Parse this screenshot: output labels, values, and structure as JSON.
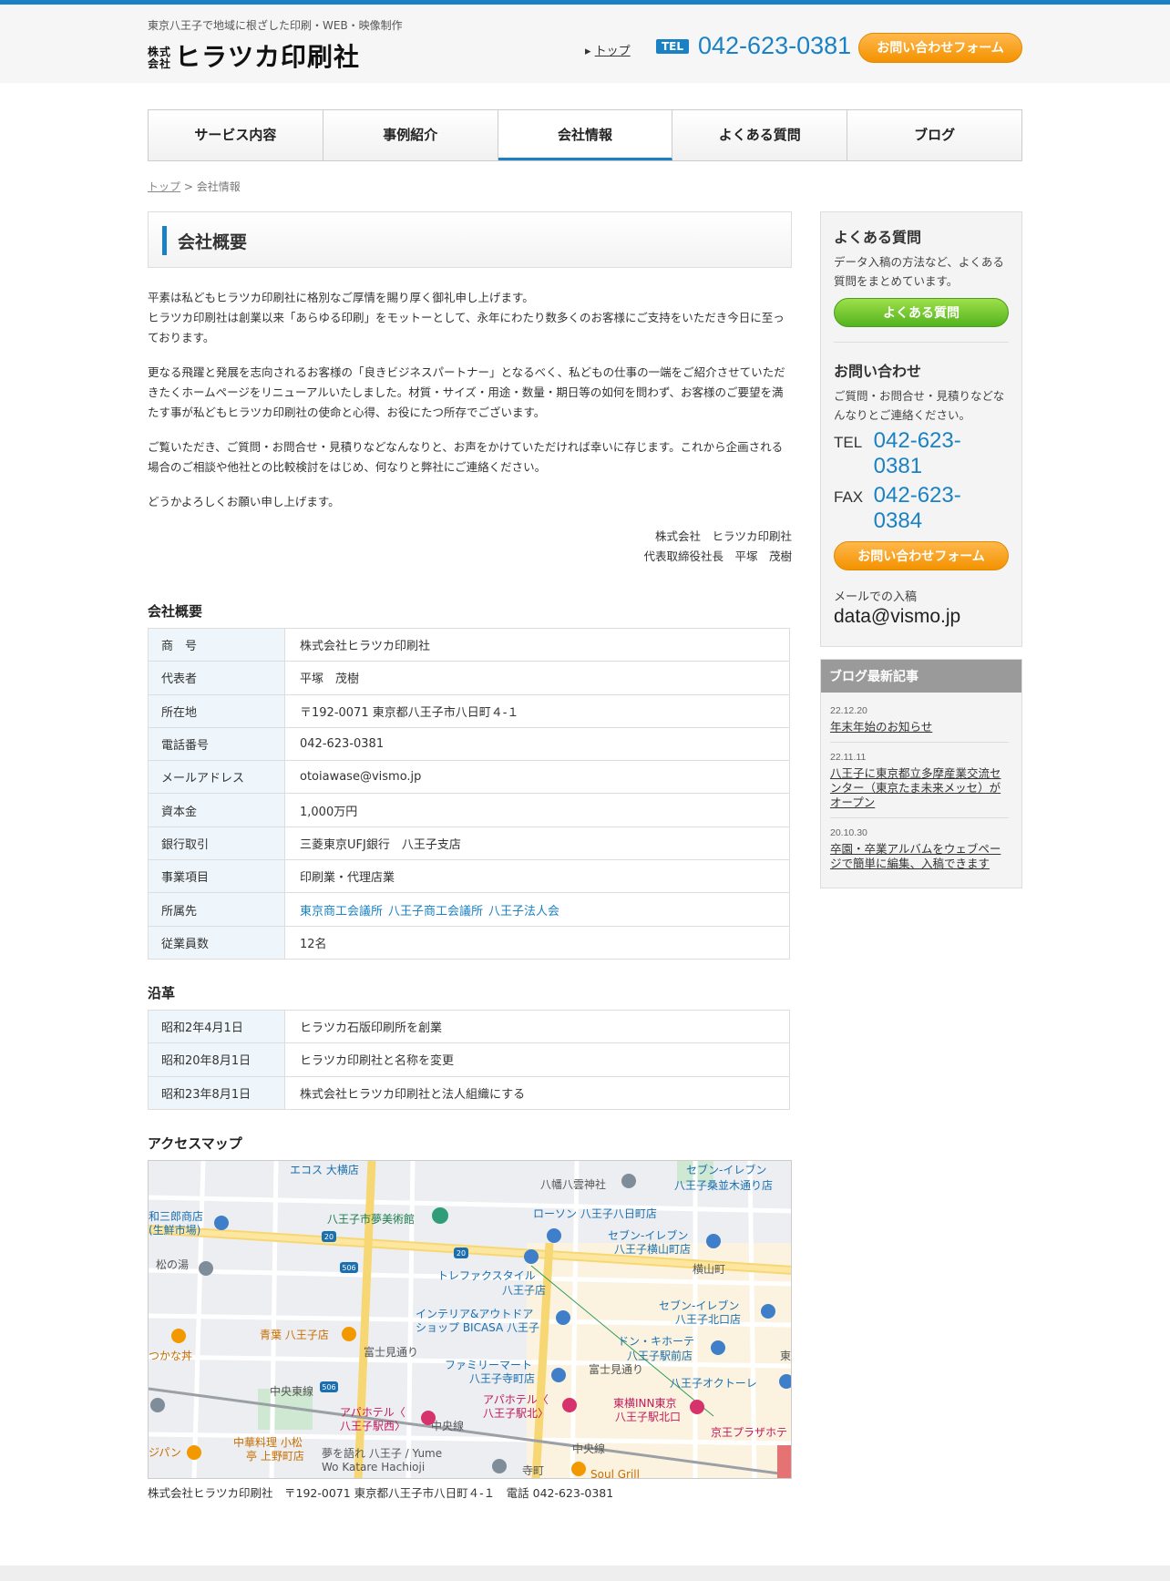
{
  "header": {
    "tagline": "東京八王子で地域に根ざした印刷・WEB・映像制作",
    "logo_small": "株式会社",
    "logo_main": "ヒラツカ印刷社",
    "top_link": "トップ",
    "tel_badge": "TEL",
    "tel": "042-623-0381",
    "contact_button": "お問い合わせフォーム"
  },
  "nav": [
    "サービス内容",
    "事例紹介",
    "会社情報",
    "よくある質問",
    "ブログ"
  ],
  "breadcrumb": {
    "home": "トップ",
    "sep": ">",
    "current": "会社情報"
  },
  "page_title": "会社概要",
  "intro": [
    "平素は私どもヒラツカ印刷社に格別なご厚情を賜り厚く御礼申し上げます。\nヒラツカ印刷社は創業以来「あらゆる印刷」をモットーとして、永年にわたり数多くのお客様にご支持をいただき今日に至っております。",
    "更なる飛躍と発展を志向されるお客様の「良きビジネスパートナー」となるべく、私どもの仕事の一端をご紹介させていただきたくホームページをリニューアルいたしました。材質・サイズ・用途・数量・期日等の如何を問わず、お客様のご要望を満たす事が私どもヒラツカ印刷社の使命と心得、お役にたつ所存でございます。",
    "ご覧いただき、ご質問・お問合せ・見積りなどなんなりと、お声をかけていただければ幸いに存じます。これから企画される場合のご相談や他社との比較検討をはじめ、何なりと弊社にご連絡ください。",
    "どうかよろしくお願い申し上げます。"
  ],
  "signature": {
    "company": "株式会社　ヒラツカ印刷社",
    "person": "代表取締役社長　平塚　茂樹"
  },
  "company_section_title": "会社概要",
  "company_table": [
    {
      "label": "商　号",
      "value": "株式会社ヒラツカ印刷社"
    },
    {
      "label": "代表者",
      "value": "平塚　茂樹"
    },
    {
      "label": "所在地",
      "value": "〒192-0071 東京都八王子市八日町４-１"
    },
    {
      "label": "電話番号",
      "value": "042-623-0381"
    },
    {
      "label": "メールアドレス",
      "value": "otoiawase@vismo.jp"
    },
    {
      "label": "資本金",
      "value": "1,000万円"
    },
    {
      "label": "銀行取引",
      "value": "三菱東京UFJ銀行　八王子支店"
    },
    {
      "label": "事業項目",
      "value": "印刷業・代理店業"
    },
    {
      "label": "所属先",
      "links": [
        "東京商工会議所",
        "八王子商工会議所",
        "八王子法人会"
      ]
    },
    {
      "label": "従業員数",
      "value": "12名"
    }
  ],
  "history_section_title": "沿革",
  "history": [
    {
      "date": "昭和2年4月1日",
      "event": "ヒラツカ石版印刷所を創業"
    },
    {
      "date": "昭和20年8月1日",
      "event": "ヒラツカ印刷社と名称を変更"
    },
    {
      "date": "昭和23年8月1日",
      "event": "株式会社ヒラツカ印刷社と法人組織にする"
    }
  ],
  "access_section_title": "アクセスマップ",
  "map_labels": {
    "l1": "エコス 大横店",
    "l2": "八幡八雲神社",
    "l3": "セブン-イレブン",
    "l4": "八王子桑並木通り店",
    "l5": "和三郎商店",
    "l6": "(生鮮市場)",
    "l7": "八王子市夢美術館",
    "l8": "ローソン 八王子八日町店",
    "l9": "セブン-イレブン",
    "l10": "八王子横山町店",
    "l11": "松の湯",
    "l12": "横山町",
    "l13": "トレファクスタイル",
    "l14": "八王子店",
    "l15": "インテリア&アウトドア",
    "l16": "ショップ BICASA 八王子",
    "l17": "セブン-イレブン",
    "l18": "八王子北口店",
    "l19": "青葉 八王子店",
    "l20": "富士見通り",
    "l21": "ドン・キホーテ",
    "l22": "八王子駅前店",
    "l23": "ファミリーマート",
    "l24": "八王子寺町店",
    "l25": "富士見通り",
    "l26": "八王子オクトーレ",
    "l27": "中央東線",
    "l28": "アパホテル〈",
    "l29": "八王子駅西〉",
    "l30": "アパホテル〈",
    "l31": "八王子駅北〉",
    "l32": "東横INN東京",
    "l33": "八王子駅北口",
    "l34": "中央線",
    "l35": "京王プラザホテ",
    "l36": "中華料理 小松",
    "l37": "亭 上野町店",
    "l38": "夢を語れ 八王子 / Yume",
    "l39": "Wo Katare Hachioji",
    "l40": "寺町",
    "l41": "Soul Grill",
    "l42": "中央線",
    "l43": "つかな丼",
    "l44": "東",
    "l45": "ジパン",
    "r20a": "20",
    "r20b": "20",
    "r506a": "506",
    "r506b": "506"
  },
  "map_caption": "株式会社ヒラツカ印刷社　〒192-0071 東京都八王子市八日町４-１　電話 042-623-0381",
  "sidebar": {
    "faq_title": "よくある質問",
    "faq_text": "データ入稿の方法など、よくある質問をまとめています。",
    "faq_button": "よくある質問",
    "contact_title": "お問い合わせ",
    "contact_text": "ご質問・お問合せ・見積りなどなんなりとご連絡ください。",
    "tel_label": "TEL",
    "tel": "042-623-0381",
    "fax_label": "FAX",
    "fax": "042-623-0384",
    "contact_button": "お問い合わせフォーム",
    "mail_label": "メールでの入稿",
    "mail": "data@vismo.jp"
  },
  "blog": {
    "title": "ブログ最新記事",
    "posts": [
      {
        "date": "22.12.20",
        "title": "年末年始のお知らせ"
      },
      {
        "date": "22.11.11",
        "title": "八王子に東京都立多摩産業交流センター（東京たま未来メッセ）がオープン"
      },
      {
        "date": "20.10.30",
        "title": "卒園・卒業アルバムをウェブページで簡単に編集、入稿できます"
      }
    ]
  },
  "colors": {
    "accent": "#1a82c4",
    "orange": "#f39200",
    "green": "#52b31f"
  }
}
